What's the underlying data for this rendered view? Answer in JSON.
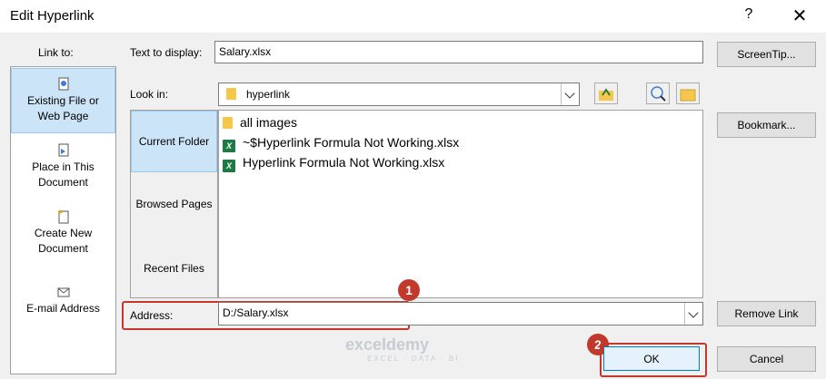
{
  "window": {
    "title": "Edit Hyperlink",
    "help": "?",
    "close": "✕"
  },
  "link_to": {
    "label": "Link to:",
    "items": [
      {
        "label_line1": "Existing File or",
        "label_line2": "Web Page"
      },
      {
        "label_line1": "Place in This",
        "label_line2": "Document"
      },
      {
        "label_line1": "Create New",
        "label_line2": "Document"
      },
      {
        "label_line1": "E-mail Address",
        "label_line2": ""
      }
    ]
  },
  "text_to_display": {
    "label": "Text to display:",
    "value": "Salary.xlsx"
  },
  "look_in": {
    "label": "Look in:",
    "value": "hyperlink"
  },
  "nav": {
    "items": [
      "Current Folder",
      "Browsed Pages",
      "Recent Files"
    ]
  },
  "files": [
    {
      "name": "all images",
      "icon": "folder-icon"
    },
    {
      "name": "~$Hyperlink Formula Not Working.xlsx",
      "icon": "excel-file-icon"
    },
    {
      "name": "Hyperlink Formula Not Working.xlsx",
      "icon": "excel-file-icon"
    }
  ],
  "address": {
    "label": "Address:",
    "value": "D:/Salary.xlsx"
  },
  "buttons": {
    "screentip": "ScreenTip...",
    "bookmark": "Bookmark...",
    "remove_link": "Remove Link",
    "ok": "OK",
    "cancel": "Cancel"
  },
  "callouts": {
    "one": "1",
    "two": "2"
  },
  "watermark": {
    "name": "exceldemy",
    "tagline": "EXCEL · DATA · BI"
  },
  "colors": {
    "accent": "#cce4f7",
    "callout": "#c0392b"
  }
}
